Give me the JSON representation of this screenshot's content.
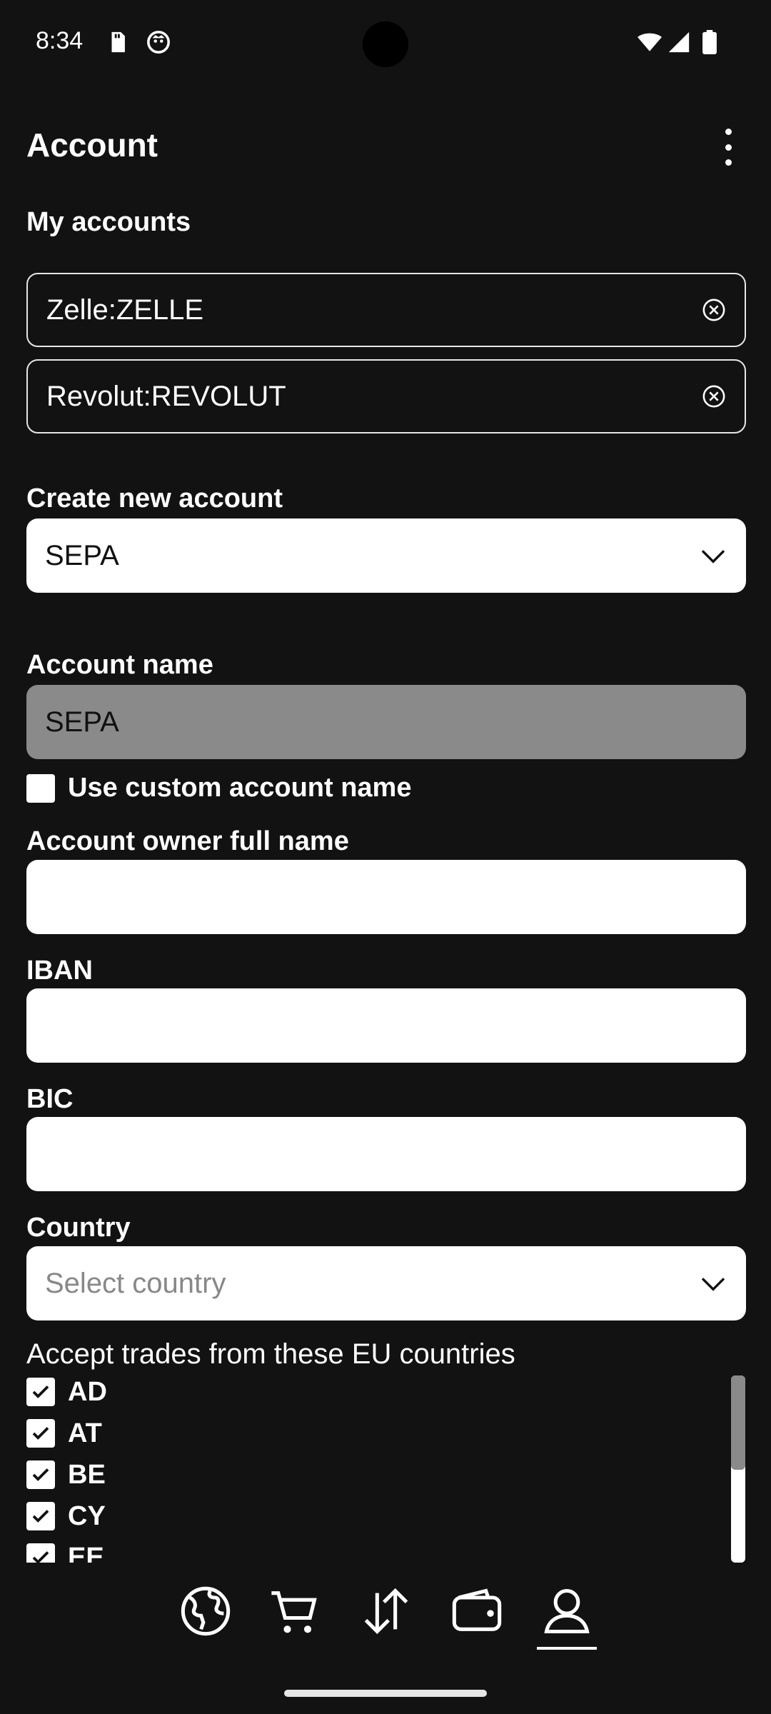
{
  "status": {
    "time": "8:34"
  },
  "header": {
    "title": "Account"
  },
  "my_accounts": {
    "label": "My accounts",
    "items": [
      "Zelle:ZELLE",
      "Revolut:REVOLUT"
    ]
  },
  "create": {
    "label": "Create new account",
    "selected": "SEPA"
  },
  "account_name": {
    "label": "Account name",
    "value": "SEPA",
    "custom_label": "Use custom account name"
  },
  "owner": {
    "label": "Account owner full name",
    "value": ""
  },
  "iban": {
    "label": "IBAN",
    "value": ""
  },
  "bic": {
    "label": "BIC",
    "value": ""
  },
  "country": {
    "label": "Country",
    "placeholder": "Select country"
  },
  "accept": {
    "label": "Accept trades from these EU countries",
    "countries": [
      "AD",
      "AT",
      "BE",
      "CY",
      "EE"
    ]
  },
  "nav": {
    "items": [
      "globe-icon",
      "cart-icon",
      "transfer-icon",
      "wallet-icon",
      "profile-icon"
    ],
    "active": "profile-icon"
  },
  "colors": {
    "background": "#121212",
    "field": "#ffffff",
    "disabled_field": "#8a8a8a"
  }
}
